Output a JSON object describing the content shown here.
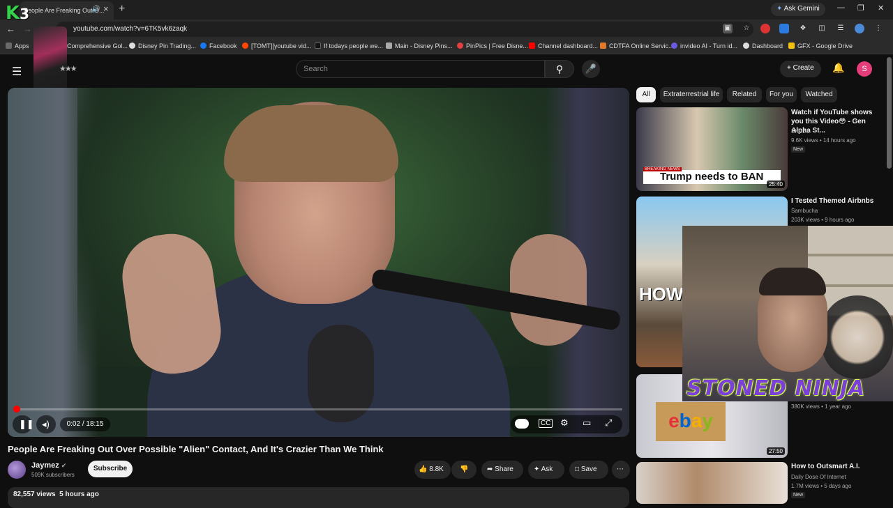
{
  "browser": {
    "tab_title": "People Are Freaking Out O...",
    "ask_gemini": "Ask Gemini",
    "url": "youtube.com/watch?v=6TK5vk6zaqk",
    "bookmarks": [
      {
        "label": "Apps",
        "color": "#6a6a6a"
      },
      {
        "label": "Comprehensive Gol...",
        "color": "#4a8a4a"
      },
      {
        "label": "Disney Pin Trading...",
        "color": "#dddddd"
      },
      {
        "label": "Facebook",
        "color": "#1877f2"
      },
      {
        "label": "[TOMT][youtube vid...",
        "color": "#ff4500"
      },
      {
        "label": "If todays people we...",
        "color": "#111111"
      },
      {
        "label": "Main - Disney Pins...",
        "color": "#aaaaaa"
      },
      {
        "label": "PinPics | Free Disne...",
        "color": "#e04040"
      },
      {
        "label": "Channel dashboard...",
        "color": "#ff0000"
      },
      {
        "label": "CDTFA Online Servic...",
        "color": "#e07a2a"
      },
      {
        "label": "invideo AI - Turn id...",
        "color": "#6a5ae0"
      },
      {
        "label": "Dashboard",
        "color": "#dddddd"
      },
      {
        "label": "GFX - Google Drive",
        "color": "#f4c20d"
      }
    ]
  },
  "youtube": {
    "search_placeholder": "Search",
    "create_label": "Create",
    "avatar_letter": "S"
  },
  "player": {
    "time": "0:02 / 18:15",
    "progress_fraction": 0.002
  },
  "video": {
    "title": "People Are Freaking Out Over Possible \"Alien\" Contact, And It's Crazier Than We Think",
    "channel": "Jaymez",
    "subscribers": "509K subscribers",
    "subscribe_label": "Subscribe",
    "likes": "8.8K",
    "share_label": "Share",
    "ask_label": "Ask",
    "save_label": "Save",
    "views": "82,557 views",
    "age": "5 hours ago"
  },
  "chips": [
    "All",
    "Extraterrestrial life",
    "Related",
    "For you",
    "Watched"
  ],
  "recommendations": [
    {
      "title": "Watch if YouTube shows you this Video😳 - Gen Alpha St...",
      "channel": "SKizzle",
      "meta": "9.6K views • 14 hours ago",
      "badge": "New",
      "duration": "25:40",
      "thumb_text": "Trump needs to BAN",
      "thumb_sub": "BREAKING NEWS"
    },
    {
      "title": "I Tested Themed Airbnbs",
      "channel": "Sambucha",
      "meta": "203K views • 9 hours ago",
      "badge": "",
      "duration": "",
      "thumb_text": "HOW..",
      "thumb_sub": ""
    },
    {
      "title": "",
      "channel": "",
      "meta": "380K views • 1 year ago",
      "badge": "",
      "duration": "27:50",
      "thumb_text": "ebay",
      "thumb_sub": ""
    },
    {
      "title": "How to Outsmart A.I.",
      "channel": "Daily Dose Of Internet",
      "meta": "1.7M views • 5 days ago",
      "badge": "New",
      "duration": "",
      "thumb_text": "",
      "thumb_sub": ""
    }
  ],
  "overlay": {
    "streamer_text": "STONED NINJA",
    "k3_logo": "K3"
  }
}
